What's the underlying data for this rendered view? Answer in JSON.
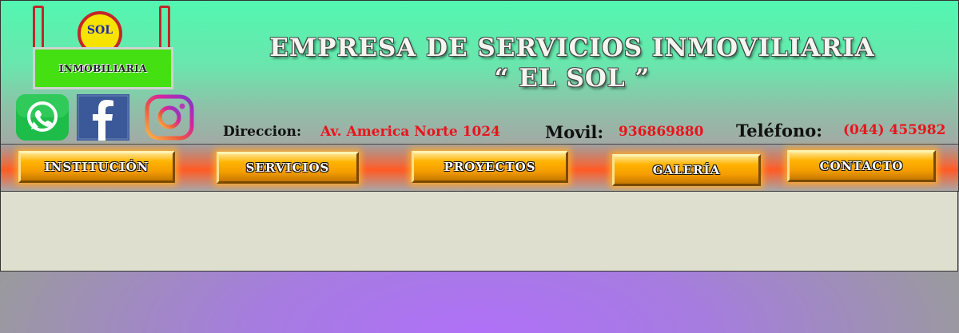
{
  "logo": {
    "sun_text": "SOL",
    "board_text": "INMOBILIARIA"
  },
  "social": [
    {
      "icon": "whatsapp-icon",
      "color": "#1ebd4a"
    },
    {
      "icon": "facebook-icon",
      "color": "#3b5998"
    },
    {
      "icon": "instagram-icon",
      "color": "#d6249f"
    }
  ],
  "header": {
    "title_line1": "EMPRESA DE SERVICIOS INMOVILIARIA",
    "title_line2": "“ EL SOL ”"
  },
  "contact": {
    "address_label": "Direccion:",
    "address_value": "Av. America Norte 1024",
    "mobile_label": "Movil:",
    "mobile_value": "936869880",
    "phone_label": "Teléfono:",
    "phone_value": "(044) 455982"
  },
  "nav": {
    "items": [
      "INSTITUCIÓN",
      "SERVICIOS",
      "PROYECTOS",
      "GALERÍA",
      "CONTACTO"
    ]
  },
  "colors": {
    "accent_red": "#e8141c",
    "header_green": "#52f7b0",
    "nav_orange": "#ff5a24",
    "button_gold": "#ffb300",
    "content_bg": "#dfdfd0"
  }
}
